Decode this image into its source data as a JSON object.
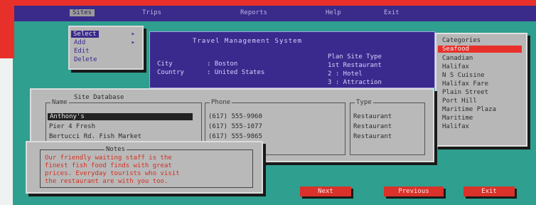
{
  "menubar": {
    "items": [
      "",
      "Sites",
      "Trips",
      "Reports",
      "Help",
      "Exit"
    ]
  },
  "file_menu": {
    "items": [
      "Select",
      "Add",
      "Edit",
      "Delete"
    ]
  },
  "travel_panel": {
    "title": "Travel Management System",
    "city_label": "City",
    "city_value": ": Boston",
    "country_label": "Country",
    "country_value": ": United States",
    "site_type_label": "Plan Site Type",
    "site_type_options": [
      "1st Restaurant",
      "2 : Hotel",
      "3 : Attraction"
    ]
  },
  "right_list": {
    "items": [
      "Categories",
      "Seafood",
      "Canadian",
      "Halifax",
      "N S Cuisine",
      "Halifax Fare",
      "Plain Street",
      "Port Hill",
      "Maritime Plaza",
      "Maritime",
      "Halifax"
    ]
  },
  "site_database": {
    "title": "Site Database",
    "name_header": "Name",
    "names": [
      "Anthony's",
      "Pier 4 Fresh",
      "Bertucci Rd. Fish Market"
    ],
    "phone_header": "Phone",
    "phones": [
      "(617) 555-9960",
      "(617) 555-1077",
      "(617) 555-9865"
    ],
    "type_header": "Type",
    "types": [
      "Restaurant",
      "Restaurant",
      "Restaurant"
    ]
  },
  "notes": {
    "header": "Notes",
    "lines": [
      "Our friendly waiting staff is the",
      "finest fish food finds with great",
      "prices. Everyday tourists who visit",
      "the restaurant are with you too."
    ]
  },
  "buttons": {
    "next": "Next",
    "previous": "Previous",
    "exit": "Exit"
  }
}
